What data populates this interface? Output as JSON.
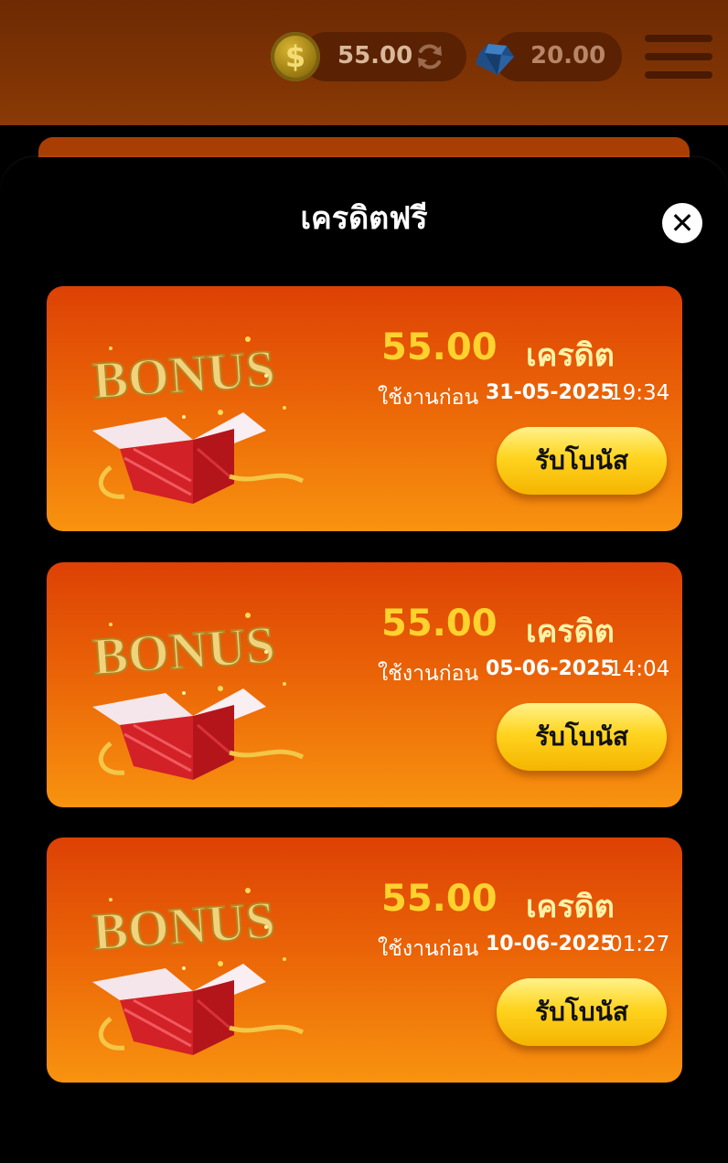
{
  "header": {
    "credit_balance": "55.00",
    "gem_balance": "20.00",
    "coin_symbol": "$"
  },
  "modal": {
    "title": "เครดิตฟรี",
    "close_symbol": "✕"
  },
  "bonuses": [
    {
      "amount": "55.00",
      "unit": "เครดิต",
      "expiry_label": "ใช้งานก่อน",
      "expiry_date": "31-05-2025",
      "expiry_time": "19:34",
      "claim_label": "รับโบนัส",
      "art_text": "BONUS"
    },
    {
      "amount": "55.00",
      "unit": "เครดิต",
      "expiry_label": "ใช้งานก่อน",
      "expiry_date": "05-06-2025",
      "expiry_time": "14:04",
      "claim_label": "รับโบนัส",
      "art_text": "BONUS"
    },
    {
      "amount": "55.00",
      "unit": "เครดิต",
      "expiry_label": "ใช้งานก่อน",
      "expiry_date": "10-06-2025",
      "expiry_time": "01:27",
      "claim_label": "รับโบนัส",
      "art_text": "BONUS"
    }
  ],
  "colors": {
    "card_top": "#dd4105",
    "card_bottom": "#f8930f",
    "amount": "#ffd22e",
    "button": "#ffd420"
  }
}
